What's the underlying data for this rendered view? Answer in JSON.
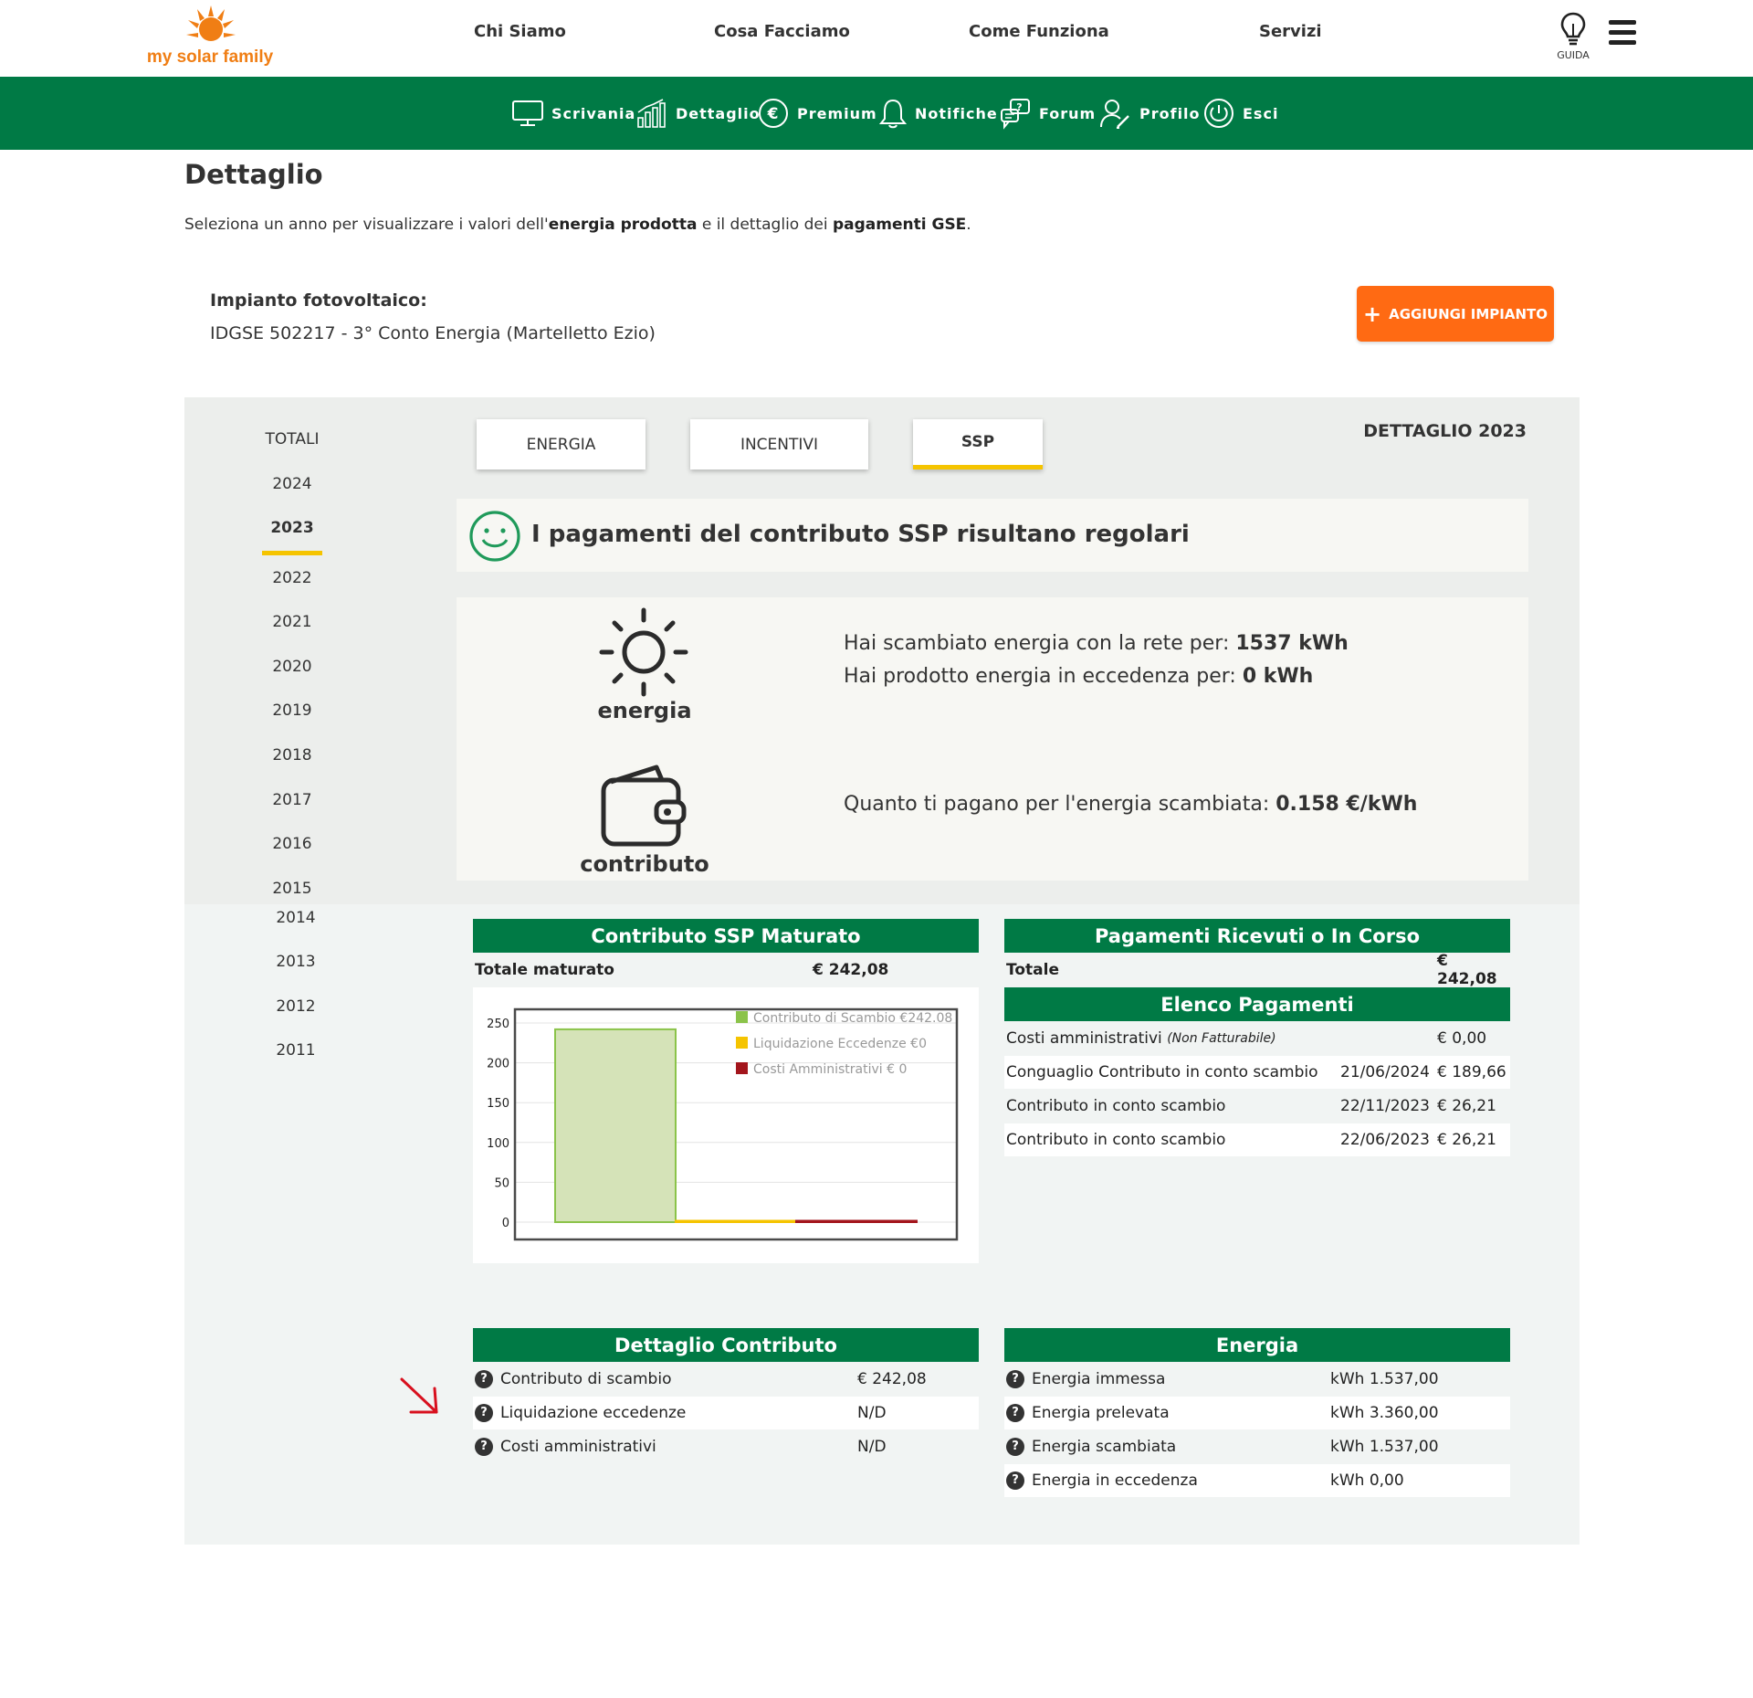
{
  "header": {
    "logo_text": "my solar family",
    "nav": [
      "Chi Siamo",
      "Cosa Facciamo",
      "Come Funziona",
      "Servizi"
    ],
    "guida_label": "GUIDA"
  },
  "subnav": {
    "items": [
      "Scrivania",
      "Dettaglio",
      "Premium",
      "Notifiche",
      "Forum",
      "Profilo",
      "Esci"
    ]
  },
  "page": {
    "title": "Dettaglio",
    "intro_1": "Seleziona un anno per visualizzare i valori dell'",
    "intro_b1": "energia prodotta",
    "intro_2": " e il dettaglio dei ",
    "intro_b2": "pagamenti GSE",
    "intro_3": ".",
    "impianto_label": "Impianto fotovoltaico:",
    "impianto_value": "IDGSE 502217 - 3° Conto Energia (Martelletto Ezio)",
    "add_button": "AGGIUNGI IMPIANTO"
  },
  "years": {
    "items": [
      "TOTALI",
      "2024",
      "2023",
      "2022",
      "2021",
      "2020",
      "2019",
      "2018",
      "2017",
      "2016",
      "2015",
      "2014",
      "2013",
      "2012",
      "2011"
    ],
    "active": "2023"
  },
  "tabs": {
    "items": [
      "ENERGIA",
      "INCENTIVI",
      "SSP"
    ],
    "active": "SSP"
  },
  "detail_year_label": "DETTAGLIO 2023",
  "status": {
    "text": "I pagamenti del contributo SSP risultano regolari"
  },
  "info": {
    "energia_label": "energia",
    "contributo_label": "contributo",
    "line1_text": "Hai scambiato energia con la rete per: ",
    "line1_value": "1537 kWh",
    "line2_text": "Hai prodotto energia in eccedenza per: ",
    "line2_value": "0 kWh",
    "line3_text": "Quanto ti pagano per l'energia scambiata: ",
    "line3_value": "0.158 €/kWh"
  },
  "maturato": {
    "title": "Contributo SSP Maturato",
    "total_label": "Totale maturato",
    "total_value": "€ 242,08"
  },
  "chart_data": {
    "type": "bar",
    "categories": [
      "Contributo di Scambio",
      "Liquidazione Eccedenze",
      "Costi Amministrativi"
    ],
    "values": [
      242.08,
      0,
      0
    ],
    "legend": [
      "Contributo di Scambio €242.08",
      "Liquidazione Eccedenze €0",
      "Costi Amministrativi € 0"
    ],
    "colors": [
      "#8bc34a",
      "#f5c400",
      "#a3151c"
    ],
    "fill_colors": [
      "#d5e3b8",
      "#f5c400",
      "#a3151c"
    ],
    "yticks": [
      "0",
      "50",
      "100",
      "150",
      "200",
      "250"
    ],
    "ylim": [
      0,
      250
    ],
    "legend_position": "top-right"
  },
  "pagamenti": {
    "title": "Pagamenti Ricevuti o In Corso",
    "total_label": "Totale",
    "total_value": "€ 242,08",
    "list_title": "Elenco Pagamenti",
    "rows": [
      {
        "label": "Costi amministrativi",
        "note": "(Non Fatturabile)",
        "date": "",
        "amount": "€ 0,00"
      },
      {
        "label": "Conguaglio Contributo in conto scambio",
        "note": "",
        "date": "21/06/2024",
        "amount": "€ 189,66"
      },
      {
        "label": "Contributo in conto scambio",
        "note": "",
        "date": "22/11/2023",
        "amount": "€ 26,21"
      },
      {
        "label": "Contributo in conto scambio",
        "note": "",
        "date": "22/06/2023",
        "amount": "€ 26,21"
      }
    ]
  },
  "dettaglio_contributo": {
    "title": "Dettaglio Contributo",
    "rows": [
      {
        "label": "Contributo di scambio",
        "value": "€ 242,08"
      },
      {
        "label": "Liquidazione eccedenze",
        "value": "N/D"
      },
      {
        "label": "Costi amministrativi",
        "value": "N/D"
      }
    ]
  },
  "energia_table": {
    "title": "Energia",
    "rows": [
      {
        "label": "Energia immessa",
        "value": "kWh 1.537,00"
      },
      {
        "label": "Energia prelevata",
        "value": "kWh 3.360,00"
      },
      {
        "label": "Energia scambiata",
        "value": "kWh 1.537,00"
      },
      {
        "label": "Energia in eccedenza",
        "value": "kWh 0,00"
      }
    ]
  },
  "colors": {
    "green": "#007a45",
    "orange": "#ff6a13",
    "yellow": "#f5c400",
    "annotation_red": "#d8101e"
  }
}
